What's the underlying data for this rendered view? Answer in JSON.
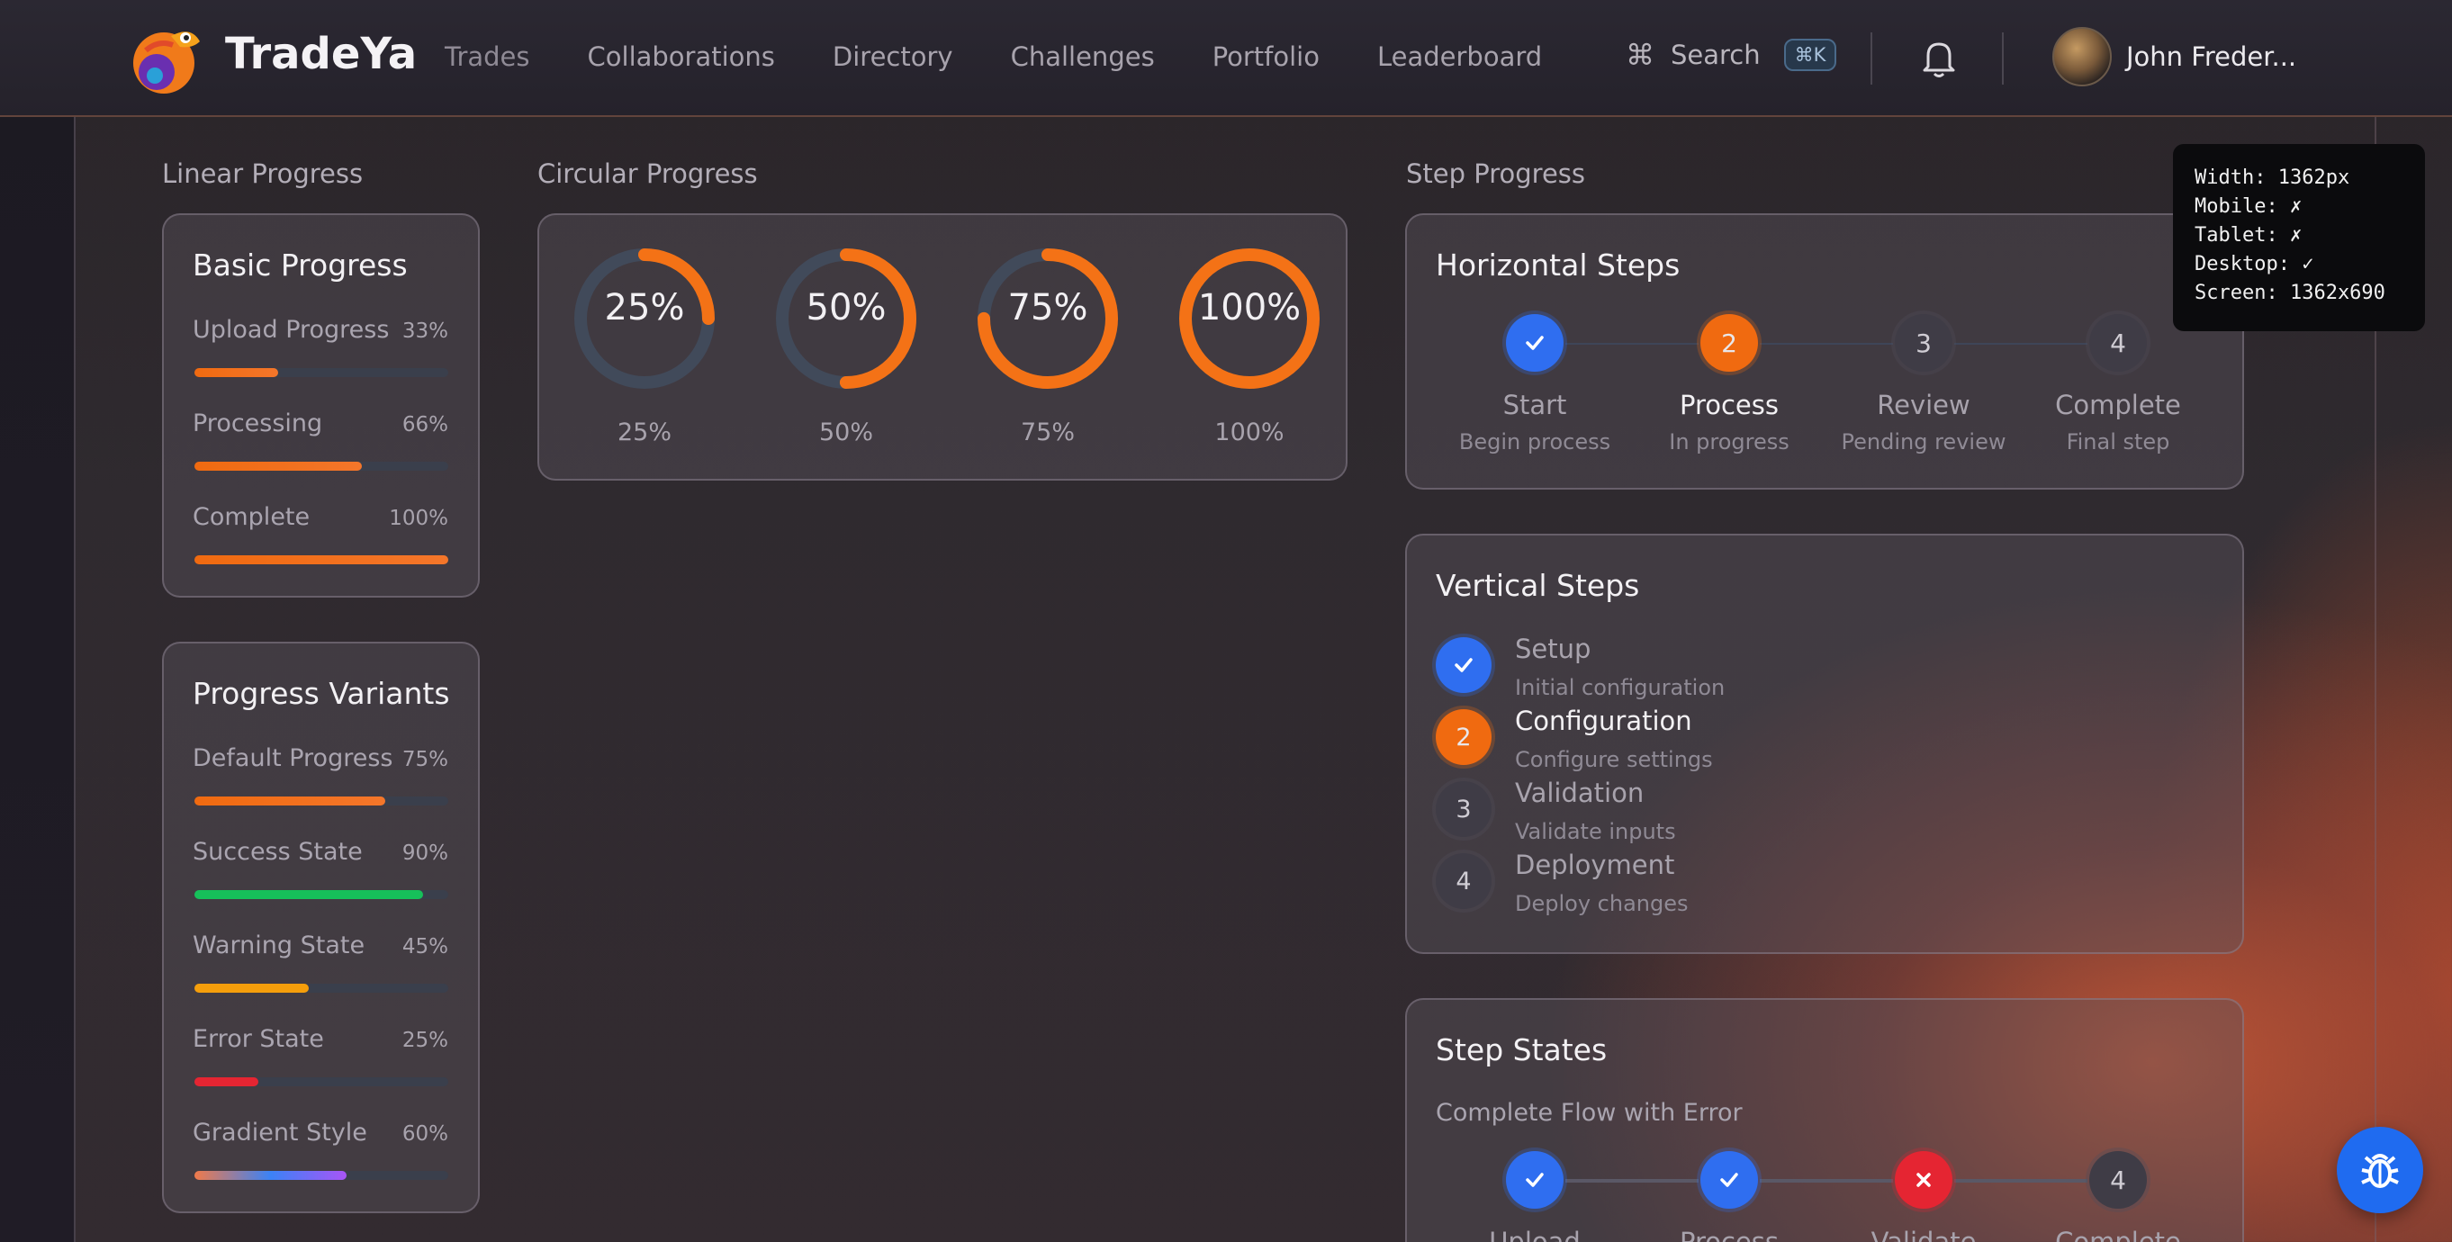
{
  "nav": {
    "brand": "TradeYa",
    "links": [
      "Trades",
      "Collaborations",
      "Directory",
      "Challenges",
      "Portfolio",
      "Leaderboard"
    ],
    "search_label": "Search",
    "search_shortcut": "⌘K",
    "user_name": "John Freder..."
  },
  "sections": {
    "linear": "Linear Progress",
    "circular": "Circular Progress",
    "step": "Step Progress"
  },
  "basic_progress": {
    "title": "Basic Progress",
    "items": [
      {
        "label": "Upload Progress",
        "value": "33%",
        "fraction": 0.33,
        "color": "#f06a10"
      },
      {
        "label": "Processing",
        "value": "66%",
        "fraction": 0.66,
        "color": "#f06a10"
      },
      {
        "label": "Complete",
        "value": "100%",
        "fraction": 1.0,
        "color": "#f06a10"
      }
    ]
  },
  "progress_variants": {
    "title": "Progress Variants",
    "items": [
      {
        "label": "Default Progress",
        "value": "75%",
        "fraction": 0.75,
        "color": "#f06a10"
      },
      {
        "label": "Success State",
        "value": "90%",
        "fraction": 0.9,
        "color": "#16c05a"
      },
      {
        "label": "Warning State",
        "value": "45%",
        "fraction": 0.45,
        "color": "#f59e0b"
      },
      {
        "label": "Error State",
        "value": "25%",
        "fraction": 0.25,
        "color": "#e52532"
      },
      {
        "label": "Gradient Style",
        "value": "60%",
        "fraction": 0.6,
        "color": "gradient"
      }
    ]
  },
  "circular": [
    {
      "center": "25%",
      "caption": "25%",
      "fraction": 0.25
    },
    {
      "center": "50%",
      "caption": "50%",
      "fraction": 0.5
    },
    {
      "center": "75%",
      "caption": "75%",
      "fraction": 0.75
    },
    {
      "center": "100%",
      "caption": "100%",
      "fraction": 1.0
    }
  ],
  "horizontal_steps": {
    "title": "Horizontal Steps",
    "steps": [
      {
        "name": "Start",
        "desc": "Begin process",
        "state": "done",
        "num": "1"
      },
      {
        "name": "Process",
        "desc": "In progress",
        "state": "active",
        "num": "2"
      },
      {
        "name": "Review",
        "desc": "Pending review",
        "state": "pending",
        "num": "3"
      },
      {
        "name": "Complete",
        "desc": "Final step",
        "state": "pending",
        "num": "4"
      }
    ]
  },
  "vertical_steps": {
    "title": "Vertical Steps",
    "steps": [
      {
        "name": "Setup",
        "desc": "Initial configuration",
        "state": "done",
        "num": "1"
      },
      {
        "name": "Configuration",
        "desc": "Configure settings",
        "state": "active",
        "num": "2"
      },
      {
        "name": "Validation",
        "desc": "Validate inputs",
        "state": "pending",
        "num": "3"
      },
      {
        "name": "Deployment",
        "desc": "Deploy changes",
        "state": "pending",
        "num": "4"
      }
    ]
  },
  "step_states": {
    "title": "Step States",
    "subtitle": "Complete Flow with Error",
    "steps": [
      {
        "name": "Upload",
        "state": "done",
        "num": "1"
      },
      {
        "name": "Process",
        "state": "done",
        "num": "2"
      },
      {
        "name": "Validate",
        "state": "error",
        "num": "3"
      },
      {
        "name": "Complete",
        "state": "pending",
        "num": "4"
      }
    ]
  },
  "tooltip": "Width: 1362px\nMobile: ✗\nTablet: ✗\nDesktop: ✓\nScreen: 1362x690",
  "colors": {
    "accent": "#f06a10",
    "primary_blue": "#2f6ef0",
    "success": "#16c05a",
    "warning": "#f59e0b",
    "error": "#e52532"
  }
}
